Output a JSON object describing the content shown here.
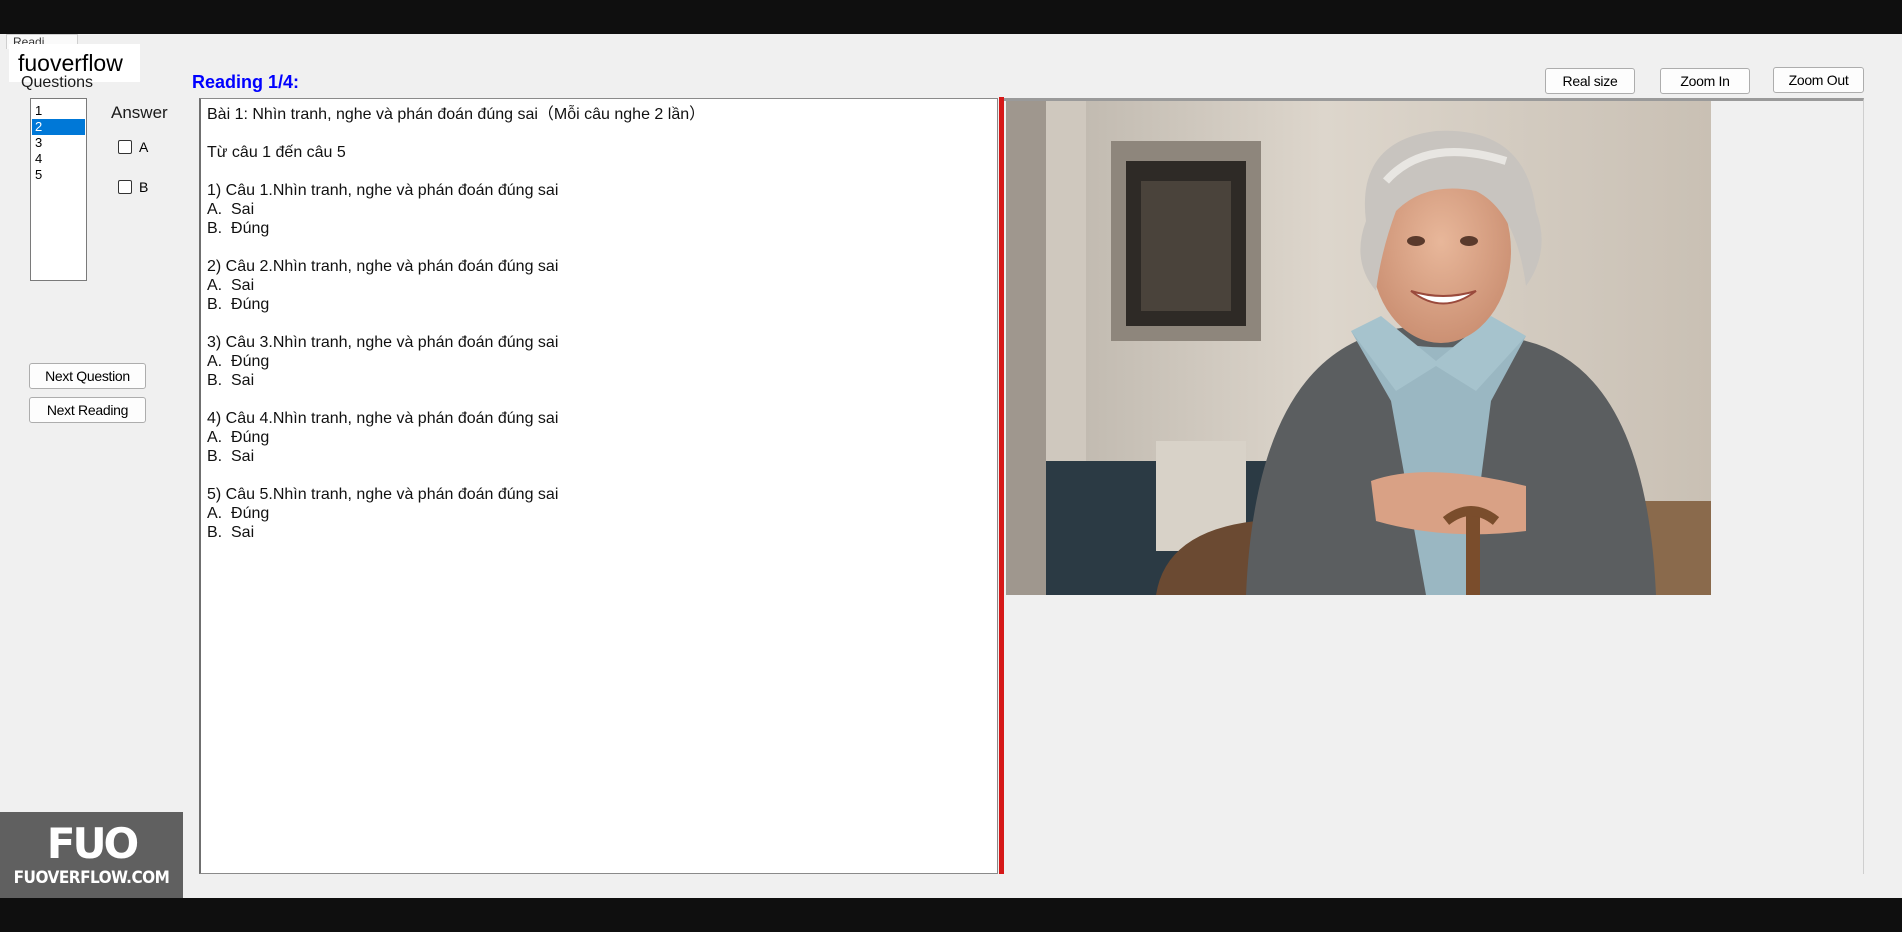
{
  "window": {
    "tab_label": "Readi"
  },
  "overlay_label": "fuoverflow",
  "questions": {
    "label": "Questions",
    "items": [
      "1",
      "2",
      "3",
      "4",
      "5"
    ],
    "selected_index": 1
  },
  "answer": {
    "label": "Answer",
    "options": [
      "A",
      "B"
    ]
  },
  "buttons": {
    "next_question": "Next Question",
    "next_reading": "Next Reading",
    "real_size": "Real size",
    "zoom_in": "Zoom In",
    "zoom_out": "Zoom Out"
  },
  "reading": {
    "title": "Reading 1/4:",
    "lines": [
      "Bài 1: Nhìn tranh, nghe và phán đoán đúng sai（Mỗi câu nghe 2 lần）",
      "",
      "Từ câu 1 đến câu 5",
      "",
      "1) Câu 1.Nhìn tranh, nghe và phán đoán đúng sai",
      "A.  Sai",
      "B.  Đúng",
      "",
      "2) Câu 2.Nhìn tranh, nghe và phán đoán đúng sai",
      "A.  Sai",
      "B.  Đúng",
      "",
      "3) Câu 3.Nhìn tranh, nghe và phán đoán đúng sai",
      "A.  Đúng",
      "B.  Sai",
      "",
      "4) Câu 4.Nhìn tranh, nghe và phán đoán đúng sai",
      "A.  Đúng",
      "B.  Sai",
      "",
      "5) Câu 5.Nhìn tranh, nghe và phán đoán đúng sai",
      "A.  Đúng",
      "B.  Sai"
    ]
  },
  "watermark": {
    "logo": "FUO",
    "text": "FUOVERFLOW.COM"
  },
  "colors": {
    "reading_title": "#0000ff",
    "divider": "#d61818",
    "selected": "#0078d7"
  }
}
